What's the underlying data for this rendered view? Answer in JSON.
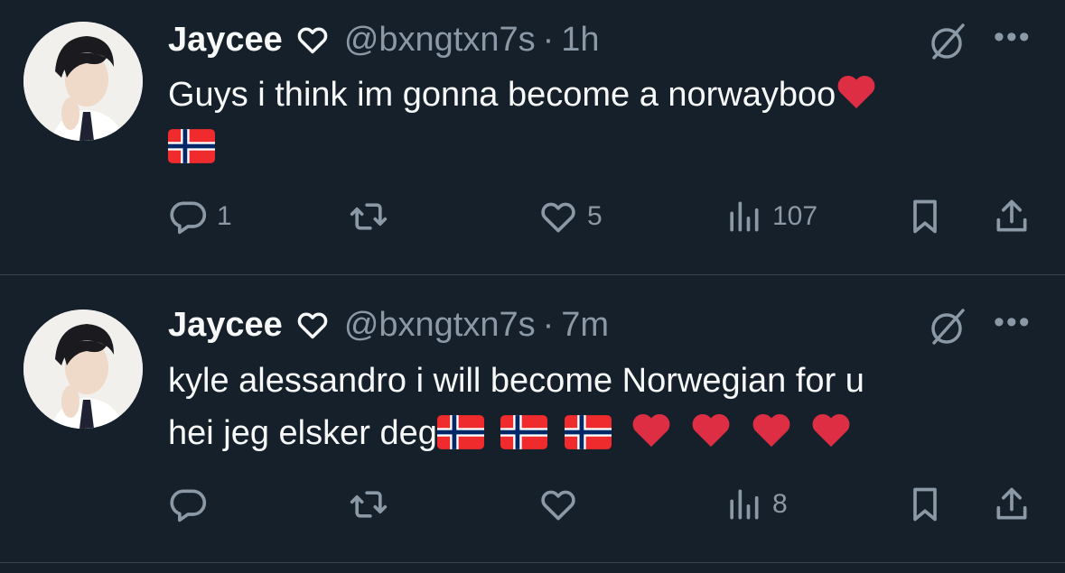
{
  "tweets": [
    {
      "name": "Jaycee",
      "handle": "@bxngtxn7s",
      "separator": "·",
      "time": "1h",
      "text_line1": "Guys i think im gonna become a norwayboo",
      "actions": {
        "replies": "1",
        "retweets": "",
        "likes": "5",
        "views": "107"
      }
    },
    {
      "name": "Jaycee",
      "handle": "@bxngtxn7s",
      "separator": "·",
      "time": "7m",
      "text_line1": "kyle alessandro i will become Norwegian for u",
      "text_line2": "hei jeg elsker deg",
      "actions": {
        "replies": "",
        "retweets": "",
        "likes": "",
        "views": "8"
      }
    }
  ],
  "colors": {
    "background": "#15202b",
    "text": "#f7f9f9",
    "muted": "#8b98a5",
    "divider": "#38444d"
  },
  "icons": [
    "heart-outline-icon",
    "grok-icon",
    "more-icon",
    "reply-icon",
    "retweet-icon",
    "like-icon",
    "views-icon",
    "bookmark-icon",
    "share-icon",
    "red-heart-emoji",
    "norway-flag-emoji"
  ]
}
